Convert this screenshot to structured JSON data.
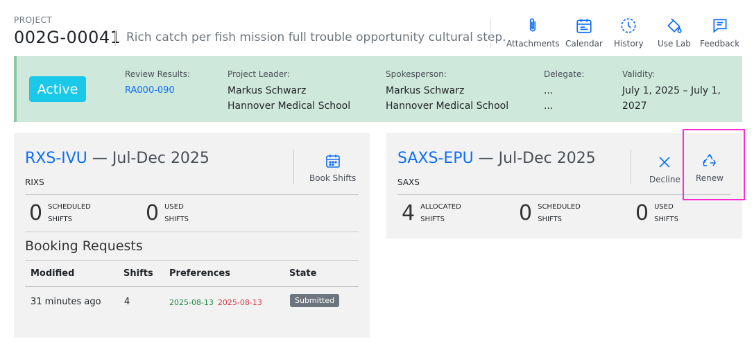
{
  "project": {
    "label": "PROJECT",
    "id": "002G-00041",
    "description": "Rich catch per fish mission full trouble opportunity cultural step."
  },
  "toolbar": {
    "attachments": "Attachments",
    "calendar": "Calendar",
    "history": "History",
    "use_lab": "Use Lab",
    "feedback": "Feedback"
  },
  "status": {
    "badge": "Active",
    "review_label": "Review Results:",
    "review_value": "RA000-090",
    "leader_label": "Project Leader:",
    "leader_name": "Markus Schwarz",
    "leader_org": "Hannover Medical School",
    "spokes_label": "Spokesperson:",
    "spokes_name": "Markus Schwarz",
    "spokes_org": "Hannover Medical School",
    "delegate_label": "Delegate:",
    "delegate_1": "...",
    "delegate_2": "...",
    "validity_label": "Validity:",
    "validity_value": "July 1, 2025 – July 1, 2027"
  },
  "card1": {
    "code": "RXS-IVU",
    "period": " — Jul-Dec 2025",
    "subtitle": "RIXS",
    "action": "Book Shifts",
    "stats": [
      {
        "num": "0",
        "l1": "SCHEDULED",
        "l2": "SHIFTS"
      },
      {
        "num": "0",
        "l1": "USED",
        "l2": "SHIFTS"
      }
    ],
    "section": "Booking Requests",
    "headers": {
      "modified": "Modified",
      "shifts": "Shifts",
      "preferences": "Preferences",
      "state": "State"
    },
    "row": {
      "modified": "31 minutes ago",
      "shifts": "4",
      "pref1": "2025-08-13",
      "pref2": "2025-08-13",
      "state": "Submitted"
    }
  },
  "card2": {
    "code": "SAXS-EPU",
    "period": " — Jul-Dec 2025",
    "subtitle": "SAXS",
    "decline": "Decline",
    "renew": "Renew",
    "stats": [
      {
        "num": "4",
        "l1": "ALLOCATED",
        "l2": "SHIFTS"
      },
      {
        "num": "0",
        "l1": "SCHEDULED",
        "l2": "SHIFTS"
      },
      {
        "num": "0",
        "l1": "USED",
        "l2": "SHIFTS"
      }
    ]
  },
  "colors": {
    "accent": "#0d6efd",
    "active_badge": "#1ac8e8",
    "band": "#cfe8dc",
    "highlight": "#ff2bd1"
  }
}
